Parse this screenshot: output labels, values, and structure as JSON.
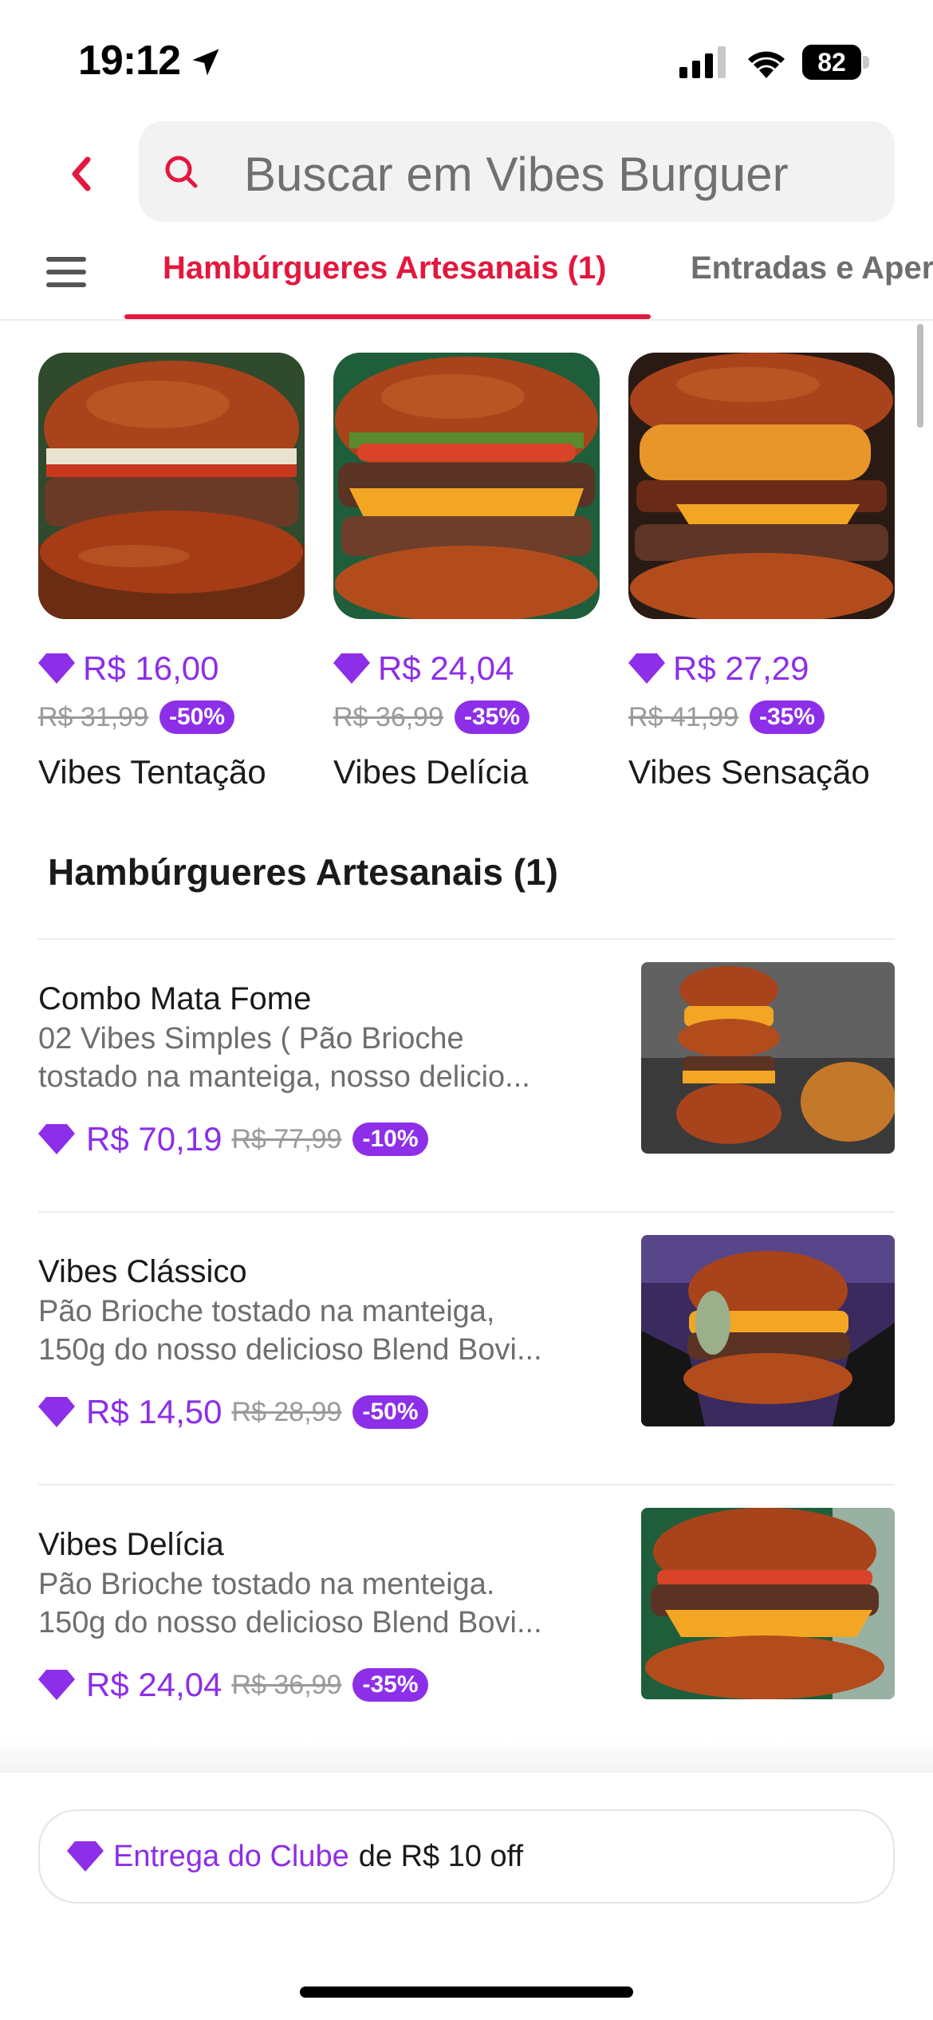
{
  "status_bar": {
    "time": "19:12",
    "battery": "82"
  },
  "search": {
    "placeholder": "Buscar em Vibes Burguer"
  },
  "tabs": [
    {
      "label": "Hambúrgueres Artesanais (1)",
      "active": true
    },
    {
      "label": "Entradas e Aper",
      "active": false
    }
  ],
  "featured": [
    {
      "price": "R$ 16,00",
      "old_price": "R$ 31,99",
      "discount": "-50%",
      "name": "Vibes Tentação"
    },
    {
      "price": "R$ 24,04",
      "old_price": "R$ 36,99",
      "discount": "-35%",
      "name": "Vibes Delícia"
    },
    {
      "price": "R$ 27,29",
      "old_price": "R$ 41,99",
      "discount": "-35%",
      "name": "Vibes Sensação"
    }
  ],
  "section": {
    "title": "Hambúrgueres Artesanais (1)"
  },
  "items": [
    {
      "title": "Combo Mata Fome",
      "desc_line1": "02 Vibes Simples ( Pão Brioche",
      "desc_line2": "tostado na manteiga, nosso delicio...",
      "price": "R$ 70,19",
      "old_price": "R$ 77,99",
      "discount": "-10%"
    },
    {
      "title": "Vibes Clássico",
      "desc_line1": "Pão Brioche tostado na manteiga,",
      "desc_line2": "150g do nosso delicioso Blend Bovi...",
      "price": "R$ 14,50",
      "old_price": "R$ 28,99",
      "discount": "-50%"
    },
    {
      "title": "Vibes Delícia",
      "desc_line1": "Pão Brioche tostado na menteiga.",
      "desc_line2": "150g do nosso delicioso Blend Bovi...",
      "price": "R$ 24,04",
      "old_price": "R$ 36,99",
      "discount": "-35%"
    }
  ],
  "club_banner": {
    "highlight": "Entrega do Clube",
    "rest": "de R$ 10 off"
  },
  "colors": {
    "brand_red": "#e3173e",
    "club_purple": "#8d2ee8"
  },
  "icons": [
    "location-arrow-icon",
    "cellular-signal-icon",
    "wifi-icon",
    "battery-icon",
    "back-chevron-icon",
    "search-icon",
    "hamburger-menu-icon",
    "diamond-icon"
  ]
}
